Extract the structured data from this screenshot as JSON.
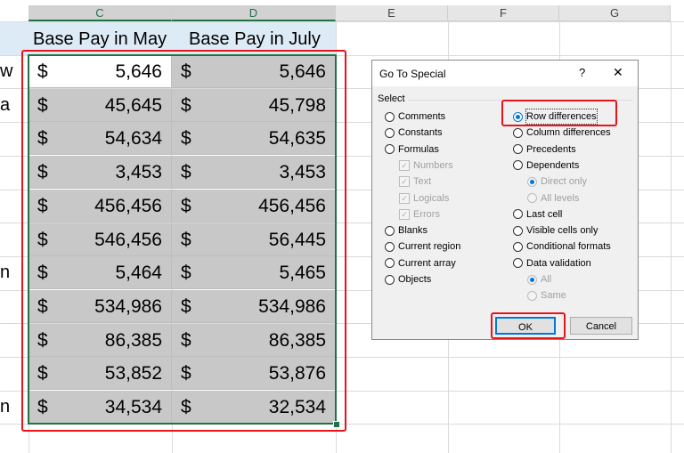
{
  "columns": [
    "C",
    "D",
    "E",
    "F",
    "G"
  ],
  "headers": {
    "c": "Base Pay in May",
    "d": "Base Pay in July"
  },
  "row_label_fragments": [
    "w",
    "a",
    "",
    "",
    "",
    "",
    "n",
    "",
    "",
    "",
    "n"
  ],
  "currency": "$",
  "rows": [
    [
      "5,646",
      "5,646"
    ],
    [
      "45,645",
      "45,798"
    ],
    [
      "54,634",
      "54,635"
    ],
    [
      "3,453",
      "3,453"
    ],
    [
      "456,456",
      "456,456"
    ],
    [
      "546,456",
      "56,445"
    ],
    [
      "5,464",
      "5,465"
    ],
    [
      "534,986",
      "534,986"
    ],
    [
      "86,385",
      "86,385"
    ],
    [
      "53,852",
      "53,876"
    ],
    [
      "34,534",
      "32,534"
    ]
  ],
  "dialog": {
    "title": "Go To Special",
    "help": "?",
    "close": "✕",
    "group": "Select",
    "left": [
      {
        "label": "Comments",
        "type": "radio"
      },
      {
        "label": "Constants",
        "type": "radio"
      },
      {
        "label": "Formulas",
        "type": "radio"
      },
      {
        "label": "Numbers",
        "type": "check",
        "disabled": true
      },
      {
        "label": "Text",
        "type": "check",
        "disabled": true
      },
      {
        "label": "Logicals",
        "type": "check",
        "disabled": true
      },
      {
        "label": "Errors",
        "type": "check",
        "disabled": true
      },
      {
        "label": "Blanks",
        "type": "radio"
      },
      {
        "label": "Current region",
        "type": "radio"
      },
      {
        "label": "Current array",
        "type": "radio"
      },
      {
        "label": "Objects",
        "type": "radio"
      }
    ],
    "right": [
      {
        "label": "Row differences",
        "type": "radio",
        "selected": true
      },
      {
        "label": "Column differences",
        "type": "radio"
      },
      {
        "label": "Precedents",
        "type": "radio"
      },
      {
        "label": "Dependents",
        "type": "radio"
      },
      {
        "label": "Direct only",
        "type": "radio",
        "disabled": true,
        "selected": true
      },
      {
        "label": "All levels",
        "type": "radio",
        "disabled": true
      },
      {
        "label": "Last cell",
        "type": "radio"
      },
      {
        "label": "Visible cells only",
        "type": "radio"
      },
      {
        "label": "Conditional formats",
        "type": "radio"
      },
      {
        "label": "Data validation",
        "type": "radio"
      },
      {
        "label": "All",
        "type": "radio",
        "disabled": true,
        "selected": true
      },
      {
        "label": "Same",
        "type": "radio",
        "disabled": true
      }
    ],
    "ok": "OK",
    "cancel": "Cancel"
  },
  "colors": {
    "highlight": "#e8141b",
    "selection": "#217346",
    "accent": "#0078d7"
  }
}
